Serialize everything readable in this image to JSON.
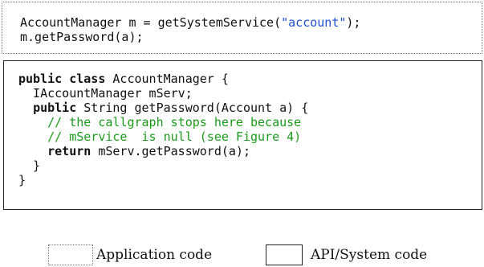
{
  "app_code": {
    "line1_prefix": "AccountManager m = getSystemService(",
    "line1_string": "\"account\"",
    "line1_suffix": ");",
    "line2": "m.getPassword(a);"
  },
  "api_code": {
    "l1_kw": "public class",
    "l1_rest": " AccountManager {",
    "l2": "  IAccountManager mServ;",
    "l3_kw": "public",
    "l3_rest": " String getPassword(Account a) {",
    "l4_comment": "// the callgraph stops here because",
    "l5_comment": "// mService  is null (see Figure 4)",
    "l6_kw": "return",
    "l6_rest": " mServ.getPassword(a);",
    "l7": "  }",
    "l8": "}"
  },
  "legend": {
    "app_label": "Application code",
    "api_label": "API/System code"
  },
  "colors": {
    "string": "#1f4fd0",
    "comment": "#1a9a1a",
    "text": "#111111"
  }
}
